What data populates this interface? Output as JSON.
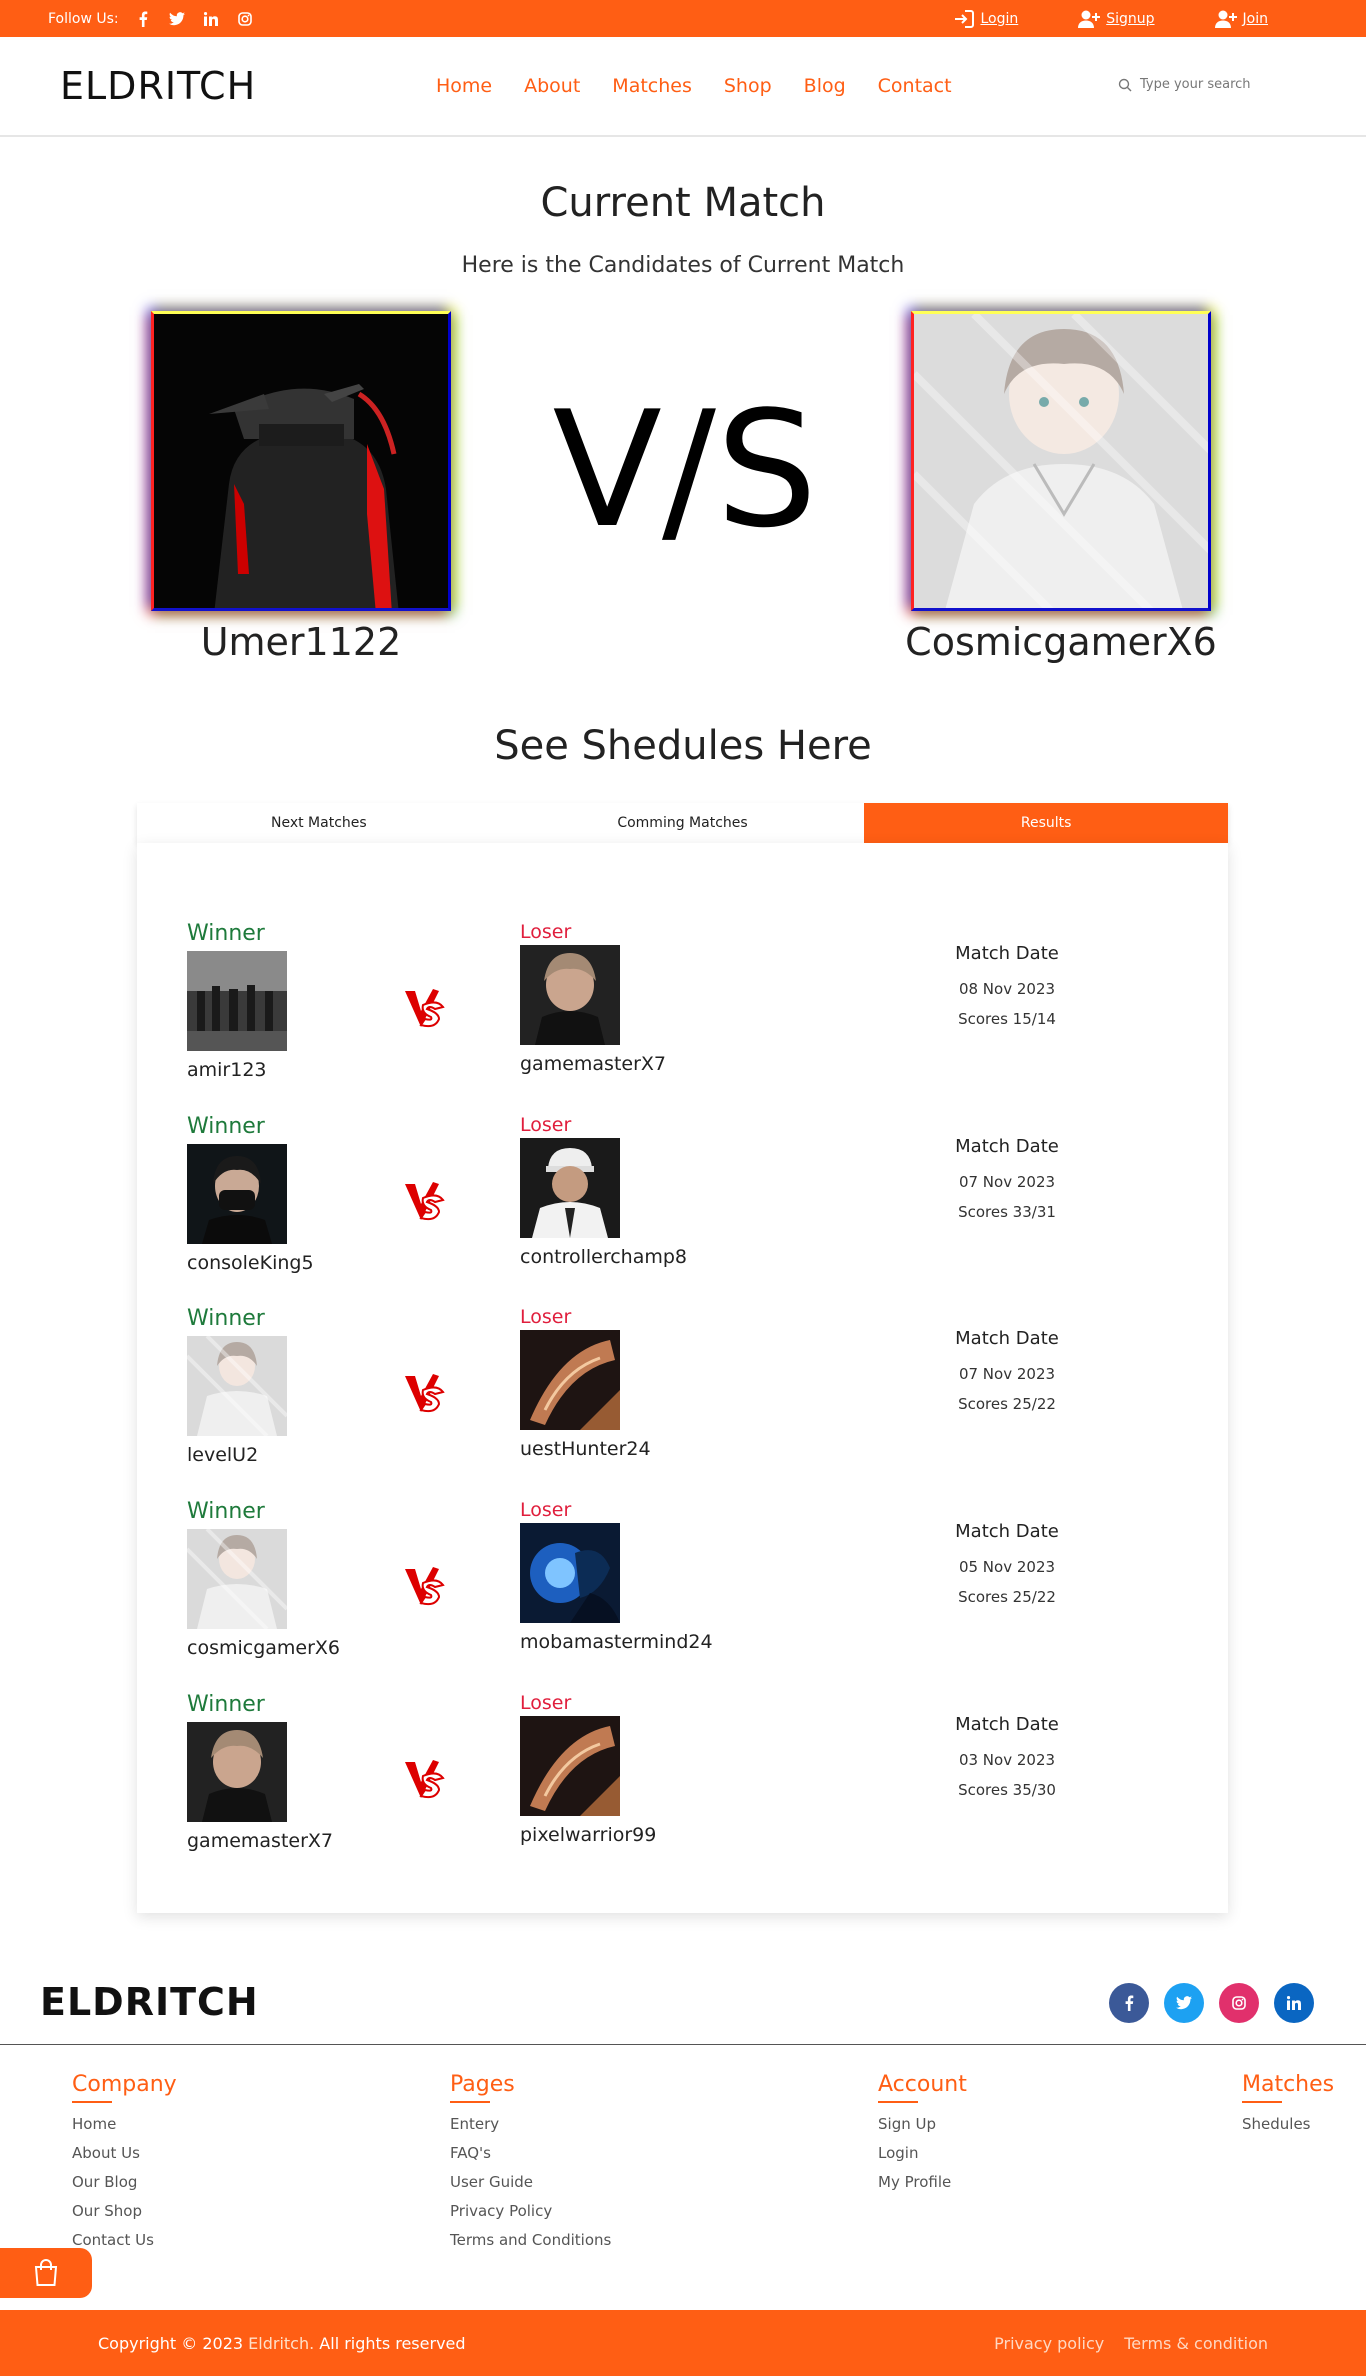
{
  "topbar": {
    "follow_label": "Follow Us:",
    "login": "Login",
    "signup": "Signup",
    "join": "Join"
  },
  "header": {
    "logo": "ELDRITCH",
    "nav": [
      "Home",
      "About",
      "Matches",
      "Shop",
      "Blog",
      "Contact"
    ],
    "search_placeholder": "Type your search"
  },
  "current_match": {
    "title": "Current Match",
    "subtitle": "Here is the Candidates of Current Match",
    "vs_text": "V/S",
    "player1": "Umer1122",
    "player2": "CosmicgamerX6"
  },
  "schedules": {
    "title": "See Shedules Here",
    "tabs": [
      "Next Matches",
      "Comming Matches",
      "Results"
    ],
    "active_tab": "Results",
    "winner_label": "Winner",
    "loser_label": "Loser",
    "match_date_label": "Match Date",
    "results": [
      {
        "winner": "amir123",
        "loser": "gamemasterX7",
        "date": "08 Nov 2023",
        "scores": "Scores 15/14"
      },
      {
        "winner": "consoleKing5",
        "loser": "controllerchamp8",
        "date": "07 Nov 2023",
        "scores": "Scores 33/31"
      },
      {
        "winner": "levelU2",
        "loser": "uestHunter24",
        "date": "07 Nov 2023",
        "scores": "Scores 25/22"
      },
      {
        "winner": "cosmicgamerX6",
        "loser": "mobamastermind24",
        "date": "05 Nov 2023",
        "scores": "Scores 25/22"
      },
      {
        "winner": "gamemasterX7",
        "loser": "pixelwarrior99",
        "date": "03 Nov 2023",
        "scores": "Scores 35/30"
      }
    ]
  },
  "footer": {
    "logo": "ELDRITCH",
    "columns": [
      {
        "title": "Company",
        "items": [
          "Home",
          "About Us",
          "Our Blog",
          "Our Shop",
          "Contact Us"
        ]
      },
      {
        "title": "Pages",
        "items": [
          "Entery",
          "FAQ's",
          "User Guide",
          "Privacy Policy",
          "Terms and Conditions"
        ]
      },
      {
        "title": "Account",
        "items": [
          "Sign Up",
          "Login",
          "My Profile"
        ]
      },
      {
        "title": "Matches",
        "items": [
          "Shedules"
        ]
      }
    ],
    "copyright_prefix": "Copyright © 2023",
    "brand": "Eldritch.",
    "rights": "All rights reserved",
    "privacy": "Privacy policy",
    "terms": "Terms & condition"
  },
  "colors": {
    "accent": "#ff5e14",
    "winner": "#1e7a3b",
    "loser": "#e01e3c",
    "facebook": "#3b5998",
    "twitter": "#1da1f2",
    "instagram": "#e1306c",
    "linkedin": "#0a66c2"
  }
}
